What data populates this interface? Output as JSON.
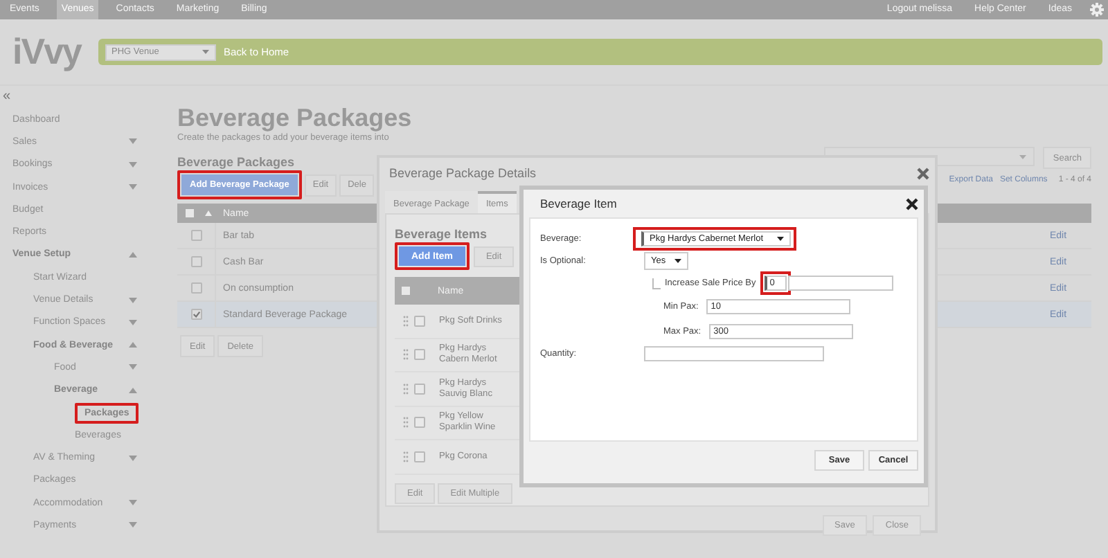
{
  "top_nav": {
    "items": [
      {
        "label": "Events",
        "selected": false
      },
      {
        "label": "Venues",
        "selected": true
      },
      {
        "label": "Contacts",
        "selected": false
      },
      {
        "label": "Marketing",
        "selected": false
      },
      {
        "label": "Billing",
        "selected": false
      }
    ],
    "links": [
      "Logout melissa",
      "Help Center",
      "Ideas"
    ]
  },
  "header": {
    "logo": "iVvy",
    "venue_select": "PHG Venue",
    "back_link": "Back to Home"
  },
  "sidebar": {
    "collapse": "«",
    "items": [
      {
        "label": "Dashboard",
        "selected": false
      },
      {
        "label": "Sales",
        "expanded": false,
        "selected": false
      },
      {
        "label": "Bookings",
        "expanded": false,
        "selected": false
      },
      {
        "label": "Invoices",
        "expanded": false,
        "selected": false
      },
      {
        "label": "Budget",
        "selected": false
      },
      {
        "label": "Reports",
        "selected": false
      },
      {
        "label": "Venue Setup",
        "expanded": true,
        "selected": false,
        "children": [
          {
            "label": "Start Wizard",
            "selected": false
          },
          {
            "label": "Venue Details",
            "expanded": false,
            "selected": false
          },
          {
            "label": "Function Spaces",
            "expanded": false,
            "selected": false
          },
          {
            "label": "Food & Beverage",
            "expanded": true,
            "selected": false,
            "children": [
              {
                "label": "Food",
                "expanded": false,
                "selected": false
              },
              {
                "label": "Beverage",
                "expanded": true,
                "selected": false,
                "children": [
                  {
                    "label": "Packages",
                    "selected": true
                  },
                  {
                    "label": "Beverages",
                    "selected": false
                  }
                ]
              }
            ]
          },
          {
            "label": "AV & Theming",
            "expanded": false,
            "selected": false
          },
          {
            "label": "Packages",
            "selected": false
          },
          {
            "label": "Accommodation",
            "expanded": false,
            "selected": false
          },
          {
            "label": "Payments",
            "expanded": false,
            "selected": false
          }
        ]
      }
    ]
  },
  "main": {
    "title": "Beverage Packages",
    "subtitle": "Create the packages to add your beverage items into",
    "section": "Beverage Packages",
    "search_button": "Search",
    "toolbar": [
      "Add Beverage Package",
      "Edit",
      "Dele"
    ],
    "tools": [
      "Export Data",
      "Set Columns"
    ],
    "pager": "1 - 4 of 4",
    "table": {
      "select_all_checked": false,
      "columns": [
        "Name"
      ],
      "rows": [
        {
          "name": "Bar tab",
          "checked": false,
          "action": "Edit"
        },
        {
          "name": "Cash Bar",
          "checked": false,
          "action": "Edit"
        },
        {
          "name": "On consumption",
          "checked": false,
          "action": "Edit"
        },
        {
          "name": "Standard Beverage Package",
          "checked": true,
          "action": "Edit"
        }
      ]
    },
    "footer_buttons": [
      "Edit",
      "Delete"
    ]
  },
  "package_dialog": {
    "title": "Beverage Package Details",
    "tabs": [
      {
        "label": "Beverage Package",
        "selected": false
      },
      {
        "label": "Items",
        "selected": true
      }
    ],
    "section": "Beverage Items",
    "add_button": "Add Item",
    "edit_button": "Edit",
    "table": {
      "select_all_checked": false,
      "columns": [
        "Name"
      ],
      "rows": [
        {
          "name": "Pkg Soft Drinks",
          "checked": false
        },
        {
          "name": "Pkg Hardys Cabern Merlot",
          "checked": false
        },
        {
          "name": "Pkg Hardys Sauvig Blanc",
          "checked": false
        },
        {
          "name": "Pkg Yellow Sparklin Wine",
          "checked": false
        },
        {
          "name": "Pkg Corona",
          "checked": false
        }
      ]
    },
    "table_buttons": [
      "Edit",
      "Edit Multiple"
    ],
    "buttons": [
      "Save",
      "Close"
    ]
  },
  "item_dialog": {
    "title": "Beverage Item",
    "beverage": {
      "label": "Beverage:",
      "value": "Pkg Hardys Cabernet Merlot"
    },
    "optional": {
      "label": "Is Optional:",
      "value": "Yes"
    },
    "increase": {
      "label": "Increase Sale Price By",
      "value": "0"
    },
    "min_pax": {
      "label": "Min Pax:",
      "value": "10"
    },
    "max_pax": {
      "label": "Max Pax:",
      "value": "300"
    },
    "quantity": {
      "label": "Quantity:"
    },
    "buttons": [
      "Save",
      "Cancel"
    ]
  }
}
